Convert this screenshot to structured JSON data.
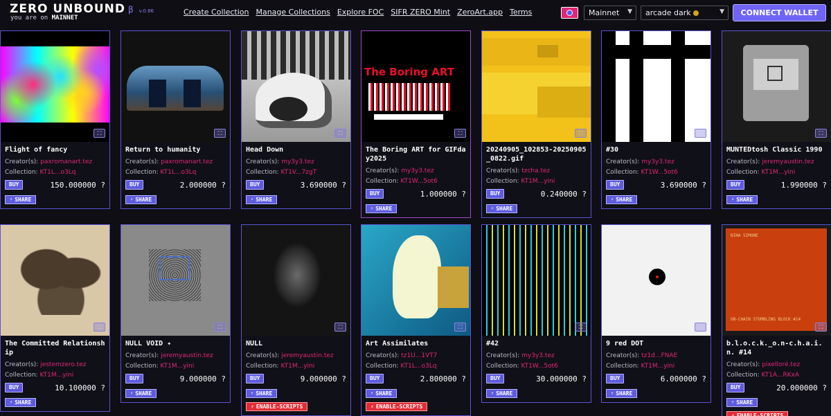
{
  "header": {
    "logo": "ZERO UNBOUND",
    "beta": "β",
    "version": "v.0.86",
    "network_note_prefix": "you are on",
    "network_note_value": "MAINNET",
    "nav": [
      "Create Collection",
      "Manage Collections",
      "Explore FOC",
      "SIFR ZERO Mint",
      "ZeroArt.app",
      "Terms"
    ],
    "network_select": "Mainnet",
    "theme_select": "arcade dark",
    "connect_label": "CONNECT WALLET"
  },
  "labels": {
    "creators": "Creator(s):",
    "collection": "Collection:",
    "buy": "BUY",
    "share": "SHARE",
    "enable_scripts": "ENABLE-SCRIPTS",
    "currency": "?"
  },
  "cards": [
    {
      "title": "Flight of fancy",
      "creator": "paxromanart.tez",
      "collection": "KT1L...o3Lq",
      "price": "150.000000"
    },
    {
      "title": "Return to humanity",
      "creator": "paxromanart.tez",
      "collection": "KT1L...o3Lq",
      "price": "2.000000"
    },
    {
      "title": "Head Down",
      "creator": "my3y3.tez",
      "collection": "KT1V...7zgT",
      "price": "3.690000"
    },
    {
      "title": "The Boring ART for GIFday2025",
      "creator": "my3y3.tez",
      "collection": "KT1W...5ot6",
      "price": "1.000000"
    },
    {
      "title": "20240905_102853-20250905_0822.gif",
      "creator": "tzcha.tez",
      "collection": "KT1M...yini",
      "price": "0.240000"
    },
    {
      "title": "#30",
      "creator": "my3y3.tez",
      "collection": "KT1W...5ot6",
      "price": "3.690000"
    },
    {
      "title": "MUNTEDtosh Classic 1990",
      "creator": "jeremyaustin.tez",
      "collection": "KT1M...yini",
      "price": "1.990000"
    },
    {
      "title": "The Committed Relationship",
      "creator": "jestemzero.tez",
      "collection": "KT1M...yini",
      "price": "10.100000"
    },
    {
      "title": "NULL VOID ✦",
      "creator": "jeremyaustin.tez",
      "collection": "KT1M...yini",
      "price": "9.000000"
    },
    {
      "title": "NULL",
      "creator": "jeremyaustin.tez",
      "collection": "KT1M...yini",
      "price": "9.000000"
    },
    {
      "title": "Art Assimilates",
      "creator": "tz1U...1VT7",
      "collection": "KT1L...o3Lq",
      "price": "2.800000"
    },
    {
      "title": "#42",
      "creator": "my3y3.tez",
      "collection": "KT1W...5ot6",
      "price": "30.000000"
    },
    {
      "title": "9 red DOT",
      "creator": "tz1d...FNAE",
      "collection": "KT1M...yini",
      "price": "6.000000"
    },
    {
      "title": "b.l.o.c.k._o.n-c.h.a.i.n. #14",
      "creator": "pixelloré.tez",
      "collection": "KT1A...RKxA",
      "price": "20.000000"
    }
  ],
  "art_text": {
    "boring": "The Boring ART",
    "nina": "NINA SIMONE",
    "chain": "ON-CHAIN STUMBLING BLOCK #14"
  },
  "colors": {
    "accent": "#5e5bde",
    "link": "#e02777",
    "border": "#5c52d6",
    "danger": "#e12c36"
  }
}
